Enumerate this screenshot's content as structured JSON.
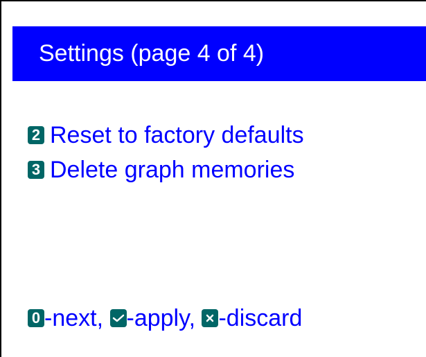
{
  "title": "Settings (page 4 of 4)",
  "colors": {
    "title_bg": "#0000ff",
    "title_text": "#ffffff",
    "text": "#0000ff",
    "key_bg": "#006666",
    "key_text": "#ffffff"
  },
  "menu": {
    "items": [
      {
        "key": "2",
        "label": "Reset to factory defaults"
      },
      {
        "key": "3",
        "label": "Delete graph memories"
      }
    ]
  },
  "footer": {
    "next": {
      "key": "0",
      "label": "-next,"
    },
    "apply": {
      "icon": "check-icon",
      "label": "-apply,"
    },
    "discard": {
      "icon": "x-icon",
      "label": "-discard"
    }
  }
}
